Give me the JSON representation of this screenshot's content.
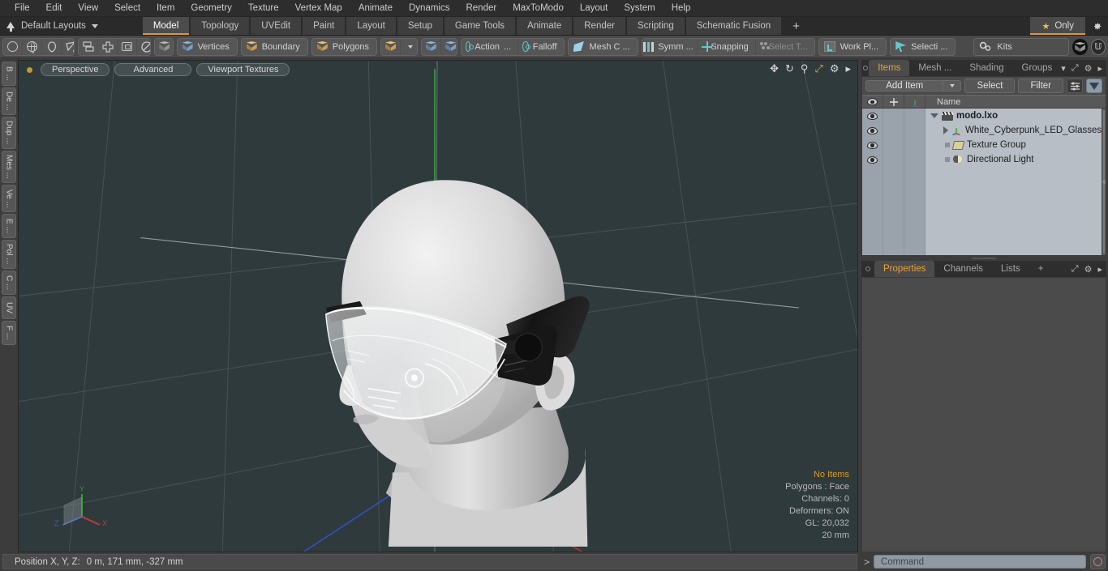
{
  "menu": {
    "items": [
      "File",
      "Edit",
      "View",
      "Select",
      "Item",
      "Geometry",
      "Texture",
      "Vertex Map",
      "Animate",
      "Dynamics",
      "Render",
      "MaxToModo",
      "Layout",
      "System",
      "Help"
    ]
  },
  "layout_bar": {
    "preset_label": "Default Layouts",
    "tabs": [
      "Model",
      "Topology",
      "UVEdit",
      "Paint",
      "Layout",
      "Setup",
      "Game Tools",
      "Animate",
      "Render",
      "Scripting",
      "Schematic Fusion"
    ],
    "active_tab": "Model",
    "add_tab_label": "+",
    "only_label": "Only",
    "gear_icon": "gear-icon"
  },
  "toolbar": {
    "shape_tools": [
      "circle-icon",
      "globe-icon",
      "pen-icon",
      "curve-icon"
    ],
    "mirror_tools": [
      "mirror-icon",
      "symmetry-icon",
      "center-icon",
      "radial-icon"
    ],
    "component_cube": "cube-icon",
    "selection_modes": [
      {
        "label": "Vertices",
        "icon": "vertices-cube-icon"
      },
      {
        "label": "Boundary",
        "icon": "boundary-cube-icon"
      },
      {
        "label": "Polygons",
        "icon": "polygons-cube-icon"
      }
    ],
    "item_mode_icon": "item-cube-icon",
    "item_mode_caret": "chevron-down-icon",
    "paint_tools": [
      "paint-cube-icon",
      "paint-cube-2-icon"
    ],
    "action_label": "Action",
    "action_suffix": "...",
    "falloff_label": "Falloff",
    "mesh_constraint_label": "Mesh C ...",
    "symmetry_label": "Symm ...",
    "snapping_label": "Snapping",
    "select_through_label": "Select T...",
    "work_plane_label": "Work Pl...",
    "selection_set_label": "Selecti ...",
    "kits_label": "Kits",
    "globe_button": "modo-globe-icon",
    "unreal_button": "unreal-icon"
  },
  "left_strip": {
    "tabs": [
      "B ...",
      "De ...",
      "Dup ...",
      "Mes ...",
      "Ve ...",
      "E ...",
      "Pol ...",
      "C ...",
      "UV",
      "F ..."
    ]
  },
  "viewport": {
    "view_label": "Perspective",
    "shading_label": "Advanced",
    "texture_label": "Viewport Textures",
    "tools": [
      "move-icon",
      "rotate-icon",
      "zoom-icon",
      "fit-icon",
      "gear-icon",
      "play-icon"
    ],
    "background_color": "#2f3a3c",
    "stats": {
      "items": "No Items",
      "polygons": "Polygons : Face",
      "channels": "Channels: 0",
      "deformers": "Deformers: ON",
      "gl": "GL: 20,032",
      "scale": "20 mm"
    },
    "axis_gizmo": {
      "x": "X",
      "y": "Y",
      "z": "Z",
      "x_color": "#c23b3b",
      "y_color": "#2fa02f",
      "z_color": "#3b5ec2"
    }
  },
  "right_panel": {
    "top_tabs": [
      "Items",
      "Mesh ...",
      "Shading",
      "Groups"
    ],
    "top_active": "Items",
    "add_item_label": "Add Item",
    "select_label": "Select",
    "filter_label": "Filter",
    "column_header_name": "Name",
    "column_icons": [
      "eye-icon",
      "move-lock-icon",
      "axis-icon"
    ],
    "tree": [
      {
        "label": "modo.lxo",
        "icon": "scene-clapper-icon",
        "depth": 0,
        "expanded": true,
        "bold": true
      },
      {
        "label": "White_Cyberpunk_LED_Glasses",
        "icon": "mesh-axis-icon",
        "depth": 1,
        "expanded": false,
        "bold": false
      },
      {
        "label": "Texture Group",
        "icon": "folder-icon",
        "depth": 1,
        "expanded": null,
        "bold": false
      },
      {
        "label": "Directional Light",
        "icon": "light-icon",
        "depth": 1,
        "expanded": null,
        "bold": false
      }
    ],
    "bottom_tabs": [
      "Properties",
      "Channels",
      "Lists"
    ],
    "bottom_active": "Properties",
    "bottom_add_label": "+"
  },
  "status_bar": {
    "position_label": "Position X, Y, Z:",
    "position_value": "0 m, 171 mm, -327 mm",
    "command_placeholder": "Command",
    "command_caret": ">",
    "command_go_icon": "run-command-icon"
  },
  "colors": {
    "accent": "#d99a2b",
    "panel": "#4b4b4b",
    "toolbar": "#4a4a4a",
    "tree_bg": "#b7bec5"
  }
}
